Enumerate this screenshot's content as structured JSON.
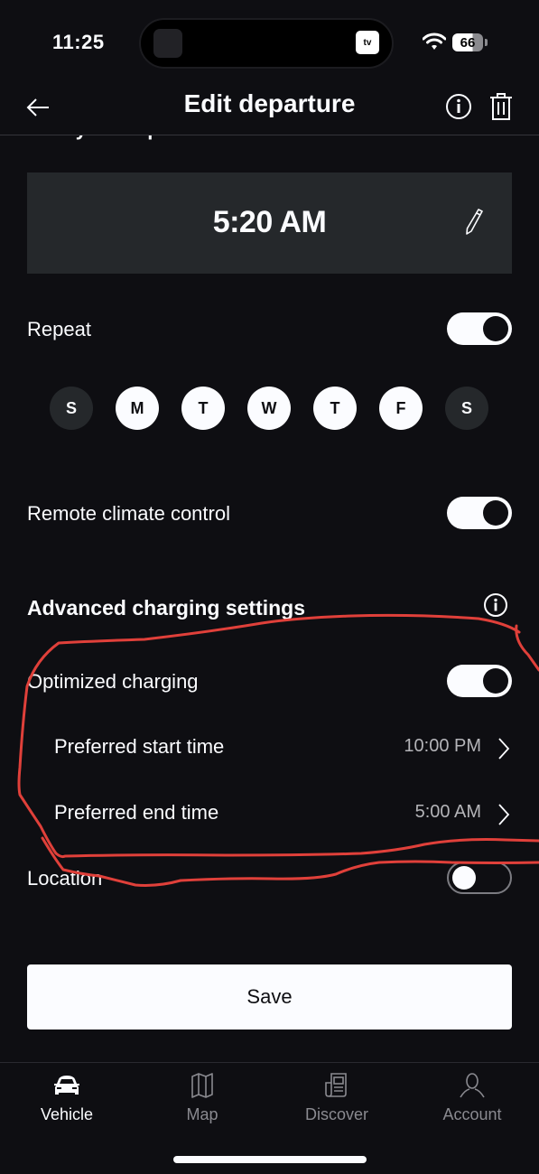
{
  "status_bar": {
    "time": "11:25",
    "island_app": "tv",
    "battery": "66",
    "battery_level_percent": 66
  },
  "header": {
    "title": "Edit departure",
    "back_icon": "arrow-left-icon",
    "info_icon": "info-icon",
    "delete_icon": "trash-icon"
  },
  "departure": {
    "label": "Ready for departure at",
    "time": "5:20 AM",
    "edit_icon": "pencil-icon"
  },
  "repeat": {
    "label": "Repeat",
    "enabled": true,
    "days": [
      {
        "label": "S",
        "name": "Sunday",
        "selected": false
      },
      {
        "label": "M",
        "name": "Monday",
        "selected": true
      },
      {
        "label": "T",
        "name": "Tuesday",
        "selected": true
      },
      {
        "label": "W",
        "name": "Wednesday",
        "selected": true
      },
      {
        "label": "T",
        "name": "Thursday",
        "selected": true
      },
      {
        "label": "F",
        "name": "Friday",
        "selected": true
      },
      {
        "label": "S",
        "name": "Saturday",
        "selected": false
      }
    ]
  },
  "climate": {
    "label": "Remote climate control",
    "enabled": true
  },
  "charging": {
    "heading": "Advanced charging settings",
    "optimized_label": "Optimized charging",
    "optimized_enabled": true,
    "start_label": "Preferred start time",
    "start_value": "10:00 PM",
    "end_label": "Preferred end time",
    "end_value": "5:00 AM"
  },
  "location": {
    "label": "Location",
    "enabled": false
  },
  "save_label": "Save",
  "tabs": [
    {
      "label": "Vehicle",
      "icon": "car-icon",
      "active": true
    },
    {
      "label": "Map",
      "icon": "map-icon",
      "active": false
    },
    {
      "label": "Discover",
      "icon": "newspaper-icon",
      "active": false
    },
    {
      "label": "Account",
      "icon": "person-icon",
      "active": false
    }
  ],
  "colors": {
    "background": "#0e0e12",
    "card": "#25282b",
    "foreground": "#fbfcff",
    "annotation": "#e0403a"
  }
}
